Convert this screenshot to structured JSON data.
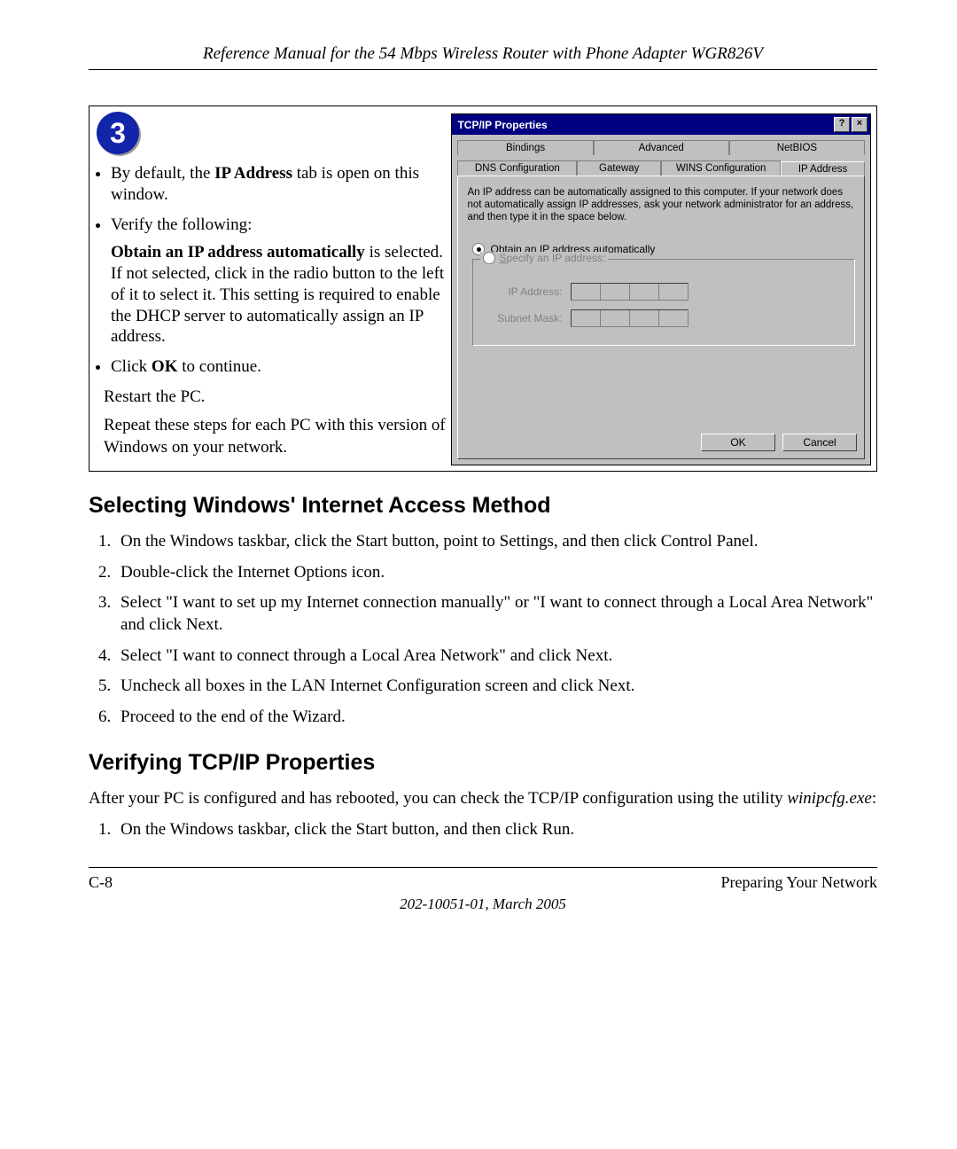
{
  "header": {
    "title": "Reference Manual for the 54 Mbps Wireless Router with Phone Adapter WGR826V"
  },
  "figure": {
    "step_number": "3",
    "bullets": {
      "b1_pre": "By default, the ",
      "b1_bold": "IP Address",
      "b1_post": " tab is open on this window.",
      "b2": "Verify the following:",
      "b2sub_bold": "Obtain an IP address automatically",
      "b2sub_post": " is selected. If not selected, click in the radio button to the left of it to select it.  This setting is required to enable the DHCP server to automatically assign an IP address.",
      "b3_pre": "Click ",
      "b3_bold": "OK",
      "b3_post": " to continue."
    },
    "para1": "Restart the PC.",
    "para2": "Repeat these steps for each PC with this version of Windows on your network."
  },
  "dialog": {
    "title": "TCP/IP Properties",
    "tabs_top": [
      "Bindings",
      "Advanced",
      "NetBIOS"
    ],
    "tabs_bottom": [
      "DNS Configuration",
      "Gateway",
      "WINS Configuration",
      "IP Address"
    ],
    "description": "An IP address can be automatically assigned to this computer. If your network does not automatically assign IP addresses, ask your network administrator for an address, and then type it in the space below.",
    "radio1_pre": "O",
    "radio1_post": "btain an IP address automatically",
    "radio2_pre": "S",
    "radio2_post": "pecify an IP address:",
    "field_ip": "IP Address:",
    "field_mask": "Subnet Mask:",
    "ok": "OK",
    "cancel": "Cancel"
  },
  "sections": {
    "h1": "Selecting Windows' Internet Access Method",
    "steps1": [
      "On the Windows taskbar, click the Start button, point to Settings, and then click Control Panel.",
      "Double-click the Internet Options icon.",
      "Select \"I want to set up my Internet connection manually\" or \"I want to connect through a Local Area Network\" and click Next.",
      "Select \"I want to connect through a Local Area Network\" and click Next.",
      "Uncheck all boxes in the LAN Internet Configuration screen and click Next.",
      "Proceed to the end of the Wizard."
    ],
    "h2": "Verifying TCP/IP Properties",
    "para_pre": "After your PC is configured and has rebooted, you can check the TCP/IP configuration using the utility ",
    "para_ital": "winipcfg.exe",
    "para_post": ":",
    "steps2": [
      "On the Windows taskbar, click the Start button, and then click Run."
    ]
  },
  "footer": {
    "left": "C-8",
    "right": "Preparing Your Network",
    "center": "202-10051-01, March 2005"
  }
}
